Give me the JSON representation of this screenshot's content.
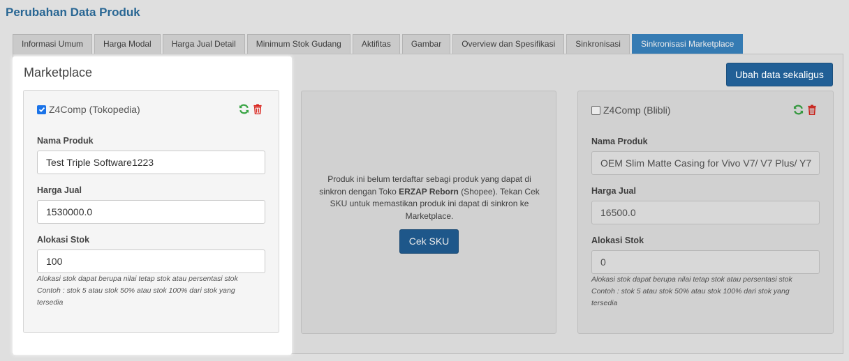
{
  "page": {
    "title": "Perubahan Data Produk"
  },
  "tabs": [
    {
      "label": "Informasi Umum",
      "active": false
    },
    {
      "label": "Harga Modal",
      "active": false
    },
    {
      "label": "Harga Jual Detail",
      "active": false
    },
    {
      "label": "Minimum Stok Gudang",
      "active": false
    },
    {
      "label": "Aktifitas",
      "active": false
    },
    {
      "label": "Gambar",
      "active": false
    },
    {
      "label": "Overview dan Spesifikasi",
      "active": false
    },
    {
      "label": "Sinkronisasi",
      "active": false
    },
    {
      "label": "Sinkronisasi Marketplace",
      "active": true
    }
  ],
  "section": {
    "title": "Marketplace",
    "bulk_button": "Ubah data sekaligus"
  },
  "cards": {
    "tokopedia": {
      "name": "Z4Comp (Tokopedia)",
      "checked": true,
      "product_label": "Nama Produk",
      "product_value": "Test Triple Software1223",
      "price_label": "Harga Jual",
      "price_value": "1530000.0",
      "stock_label": "Alokasi Stok",
      "stock_value": "100",
      "help_line1": "Alokasi stok dapat berupa nilai tetap stok atau persentasi stok",
      "help_line2": "Contoh : stok 5 atau stok 50% atau stok 100% dari stok yang",
      "help_line3": "tersedia"
    },
    "shopee": {
      "msg_part1": "Produk ini belum terdaftar sebagi produk yang dapat di sinkron dengan Toko ",
      "msg_store": "ERZAP Reborn",
      "msg_part2": " (Shopee). Tekan Cek SKU untuk memastikan produk ini dapat di sinkron ke Marketplace.",
      "button": "Cek SKU"
    },
    "blibli": {
      "name": "Z4Comp (Blibli)",
      "checked": false,
      "product_label": "Nama Produk",
      "product_value": "OEM Slim Matte Casing for Vivo V7/ V7 Plus/ Y7",
      "price_label": "Harga Jual",
      "price_value": "16500.0",
      "stock_label": "Alokasi Stok",
      "stock_value": "0",
      "help_line1": "Alokasi stok dapat berupa nilai tetap stok atau persentasi stok",
      "help_line2": "Contoh : stok 5 atau stok 50% atau stok 100% dari stok yang",
      "help_line3": "tersedia"
    }
  },
  "colors": {
    "accent": "#3a86c3",
    "button": "#215f96",
    "refresh_icon": "#3aa545",
    "delete_icon": "#d9231c"
  }
}
